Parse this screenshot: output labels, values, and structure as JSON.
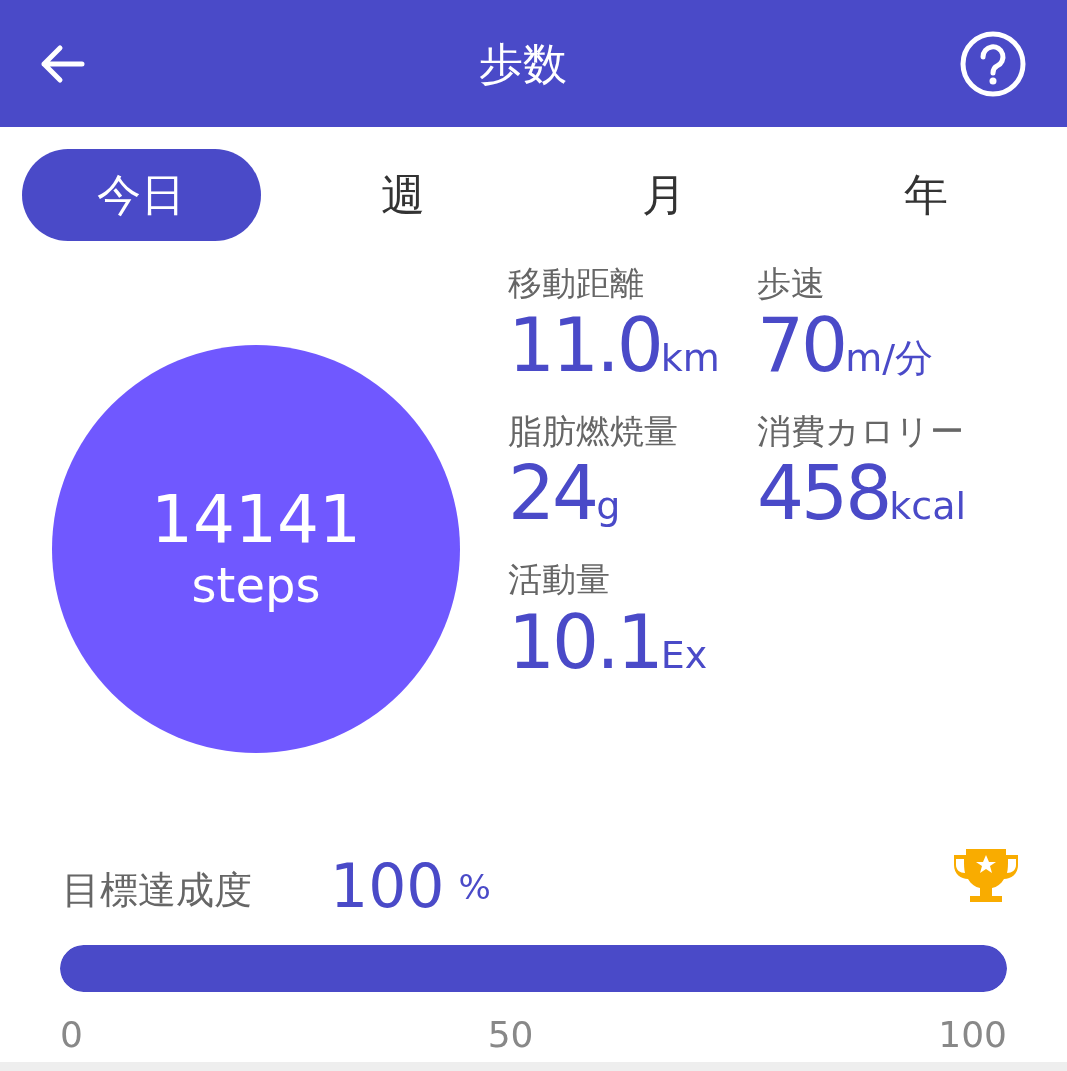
{
  "header": {
    "title": "歩数"
  },
  "tabs": [
    {
      "label": "今日",
      "selected": true
    },
    {
      "label": "週",
      "selected": false
    },
    {
      "label": "月",
      "selected": false
    },
    {
      "label": "年",
      "selected": false
    }
  ],
  "steps": {
    "count": "14141",
    "unit": "steps"
  },
  "stats": [
    {
      "label": "移動距離",
      "value": "11.0",
      "unit": "km"
    },
    {
      "label": "歩速",
      "value": "70",
      "unit": "m/分"
    },
    {
      "label": "脂肪燃焼量",
      "value": "24",
      "unit": "g"
    },
    {
      "label": "消費カロリー",
      "value": "458",
      "unit": "kcal"
    },
    {
      "label": "活動量",
      "value": "10.1",
      "unit": "Ex"
    }
  ],
  "goal": {
    "label": "目標達成度",
    "value": "100",
    "unit": "%",
    "achieved": true,
    "level": 1,
    "scale": [
      "0",
      "50",
      "100"
    ]
  }
}
